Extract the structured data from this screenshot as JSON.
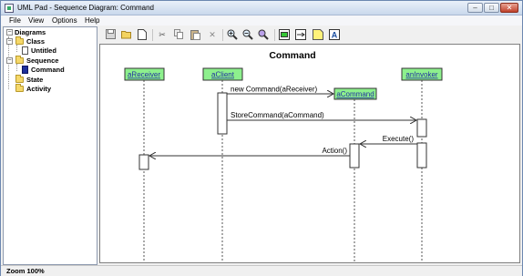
{
  "window": {
    "title": "UML Pad - Sequence Diagram: Command",
    "min": "–",
    "max": "□",
    "close": "✕"
  },
  "menu": {
    "file": "File",
    "view": "View",
    "options": "Options",
    "help": "Help"
  },
  "tree": {
    "root": "Diagrams",
    "class": "Class",
    "class_child": "Untitled",
    "sequence": "Sequence",
    "sequence_child": "Command",
    "state": "State",
    "activity": "Activity"
  },
  "toolbar_icons": [
    "save-icon",
    "open-icon",
    "new-icon",
    "cut-icon",
    "copy-icon",
    "paste-icon",
    "delete-icon",
    "zoom-in-icon",
    "zoom-out-icon",
    "zoom-fit-icon",
    "add-object-icon",
    "add-message-icon",
    "add-note-icon",
    "add-text-icon"
  ],
  "diagram": {
    "title": "Command",
    "objects": {
      "receiver": "aReceiver",
      "client": "aClient",
      "command": "aCommand",
      "invoker": "anInvoker"
    },
    "messages": {
      "new_command": "new Command(aReceiver)",
      "store_command": "StoreCommand(aCommand)",
      "execute": "Execute()",
      "action": "Action()"
    },
    "colors": {
      "object_fill": "#8df08d",
      "object_border": "#333333"
    }
  },
  "status": {
    "zoom": "Zoom 100%"
  }
}
